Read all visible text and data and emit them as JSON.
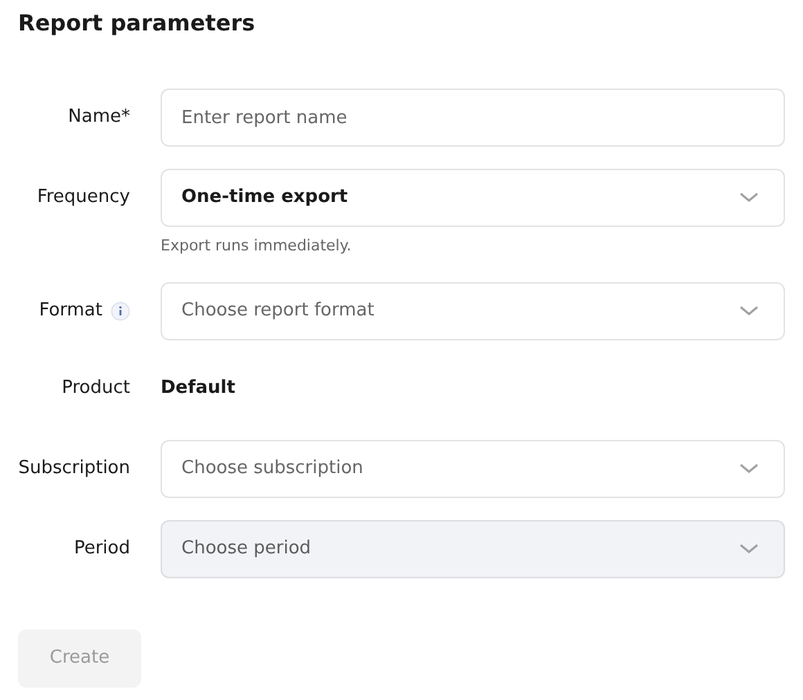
{
  "title": "Report parameters",
  "fields": [
    {
      "kind": "text",
      "label": "Name*",
      "placeholder": "Enter report name",
      "disabled": false
    },
    {
      "kind": "select",
      "label": "Frequency",
      "value": "One-time export",
      "hint": "Export runs immediately.",
      "disabled": false
    },
    {
      "kind": "select",
      "label": "Format",
      "info": true,
      "placeholder": "Choose report format",
      "disabled": false
    },
    {
      "kind": "static",
      "label": "Product",
      "value": "Default"
    },
    {
      "kind": "select",
      "label": "Subscription",
      "placeholder": "Choose subscription",
      "disabled": false
    },
    {
      "kind": "select",
      "label": "Period",
      "placeholder": "Choose period",
      "disabled": true
    }
  ],
  "create_button": {
    "label": "Create",
    "disabled": true
  }
}
